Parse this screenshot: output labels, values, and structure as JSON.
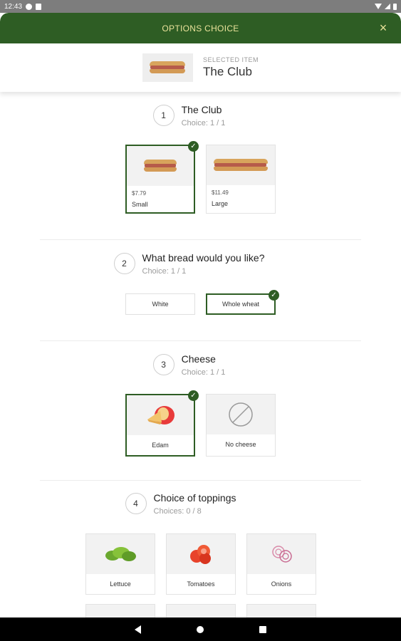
{
  "status_bar": {
    "time": "12:43"
  },
  "header": {
    "title": "OPTIONS CHOICE",
    "close_icon": "×"
  },
  "selected": {
    "label": "SELECTED ITEM",
    "name": "The Club"
  },
  "steps": [
    {
      "number": "1",
      "title": "The Club",
      "subtitle": "Choice: 1 / 1",
      "options": [
        {
          "price": "$7.79",
          "label": "Small",
          "selected": true
        },
        {
          "price": "$11.49",
          "label": "Large",
          "selected": false
        }
      ]
    },
    {
      "number": "2",
      "title": "What bread would you like?",
      "subtitle": "Choice: 1 / 1",
      "options": [
        {
          "label": "White",
          "selected": false
        },
        {
          "label": "Whole wheat",
          "selected": true
        }
      ]
    },
    {
      "number": "3",
      "title": "Cheese",
      "subtitle": "Choice: 1 / 1",
      "options": [
        {
          "label": "Edam",
          "selected": true
        },
        {
          "label": "No cheese",
          "selected": false
        }
      ]
    },
    {
      "number": "4",
      "title": "Choice of toppings",
      "subtitle": "Choices: 0 / 8",
      "options": [
        {
          "label": "Lettuce",
          "selected": false
        },
        {
          "label": "Tomatoes",
          "selected": false
        },
        {
          "label": "Onions",
          "selected": false
        }
      ]
    }
  ],
  "colors": {
    "brand_green": "#2e5d24",
    "header_text": "#e9e29a"
  }
}
